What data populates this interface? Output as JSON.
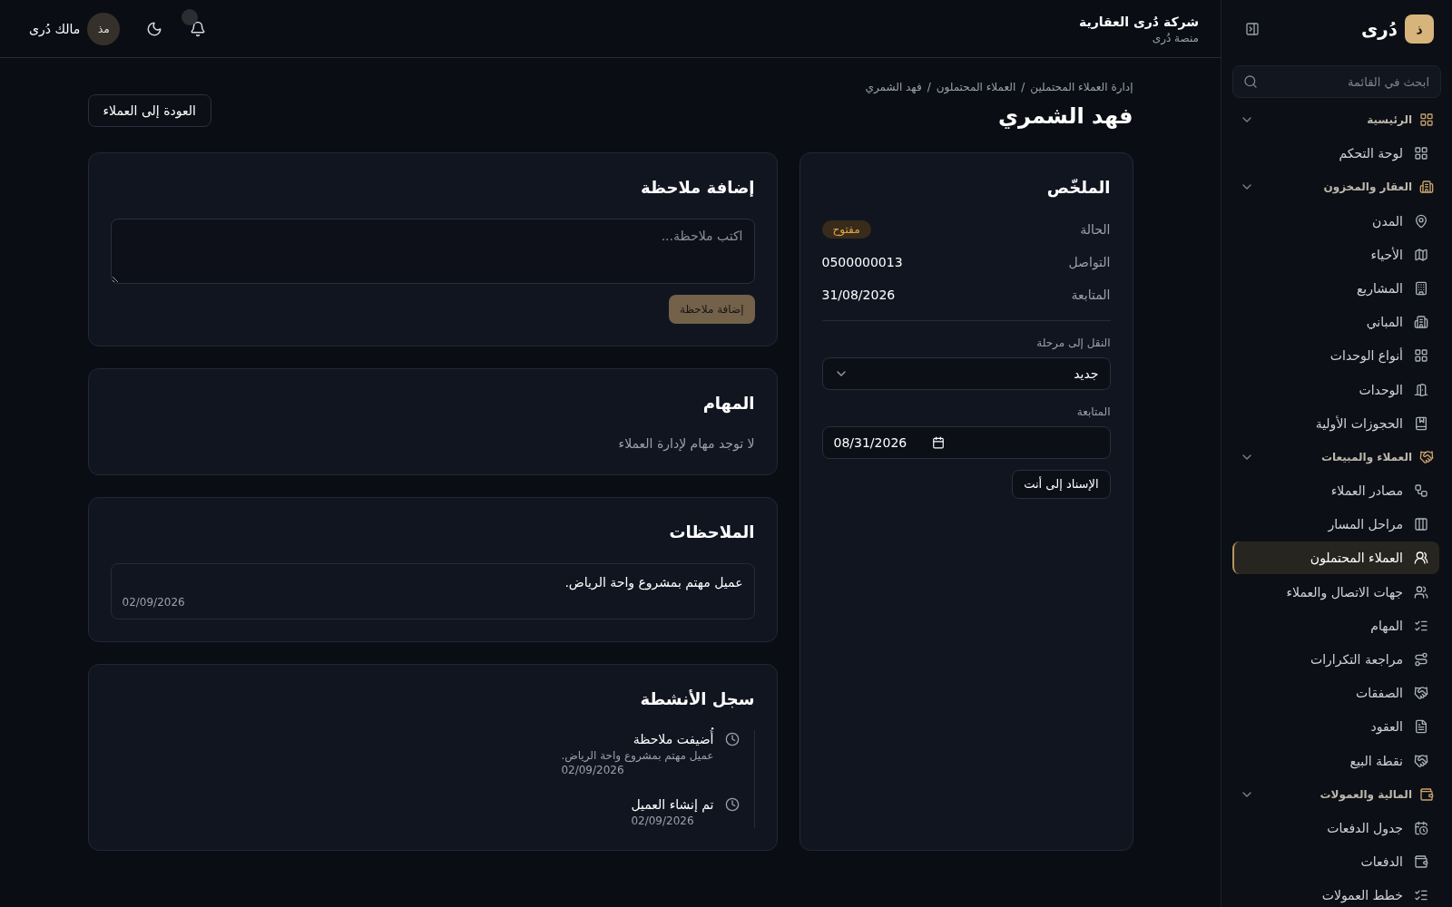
{
  "sidebar": {
    "logo_letter": "ذ",
    "brand": "دُرى",
    "search": {
      "placeholder": "ابحث في القائمة"
    },
    "sections": [
      {
        "label": "الرئيسية",
        "expanded": true,
        "items": [
          {
            "label": "لوحة التحكم",
            "selected": false
          }
        ]
      },
      {
        "label": "العقار والمخزون",
        "expanded": true,
        "items": [
          {
            "label": "المدن",
            "selected": false
          },
          {
            "label": "الأحياء",
            "selected": false
          },
          {
            "label": "المشاريع",
            "selected": false
          },
          {
            "label": "المباني",
            "selected": false
          },
          {
            "label": "أنواع الوحدات",
            "selected": false
          },
          {
            "label": "الوحدات",
            "selected": false
          },
          {
            "label": "الحجوزات الأولية",
            "selected": false
          }
        ]
      },
      {
        "label": "العملاء والمبيعات",
        "expanded": true,
        "items": [
          {
            "label": "مصادر العملاء",
            "selected": false
          },
          {
            "label": "مراحل المسار",
            "selected": false
          },
          {
            "label": "العملاء المحتملون",
            "selected": true
          },
          {
            "label": "جهات الاتصال والعملاء",
            "selected": false
          },
          {
            "label": "المهام",
            "selected": false
          },
          {
            "label": "مراجعة التكرارات",
            "selected": false
          },
          {
            "label": "الصفقات",
            "selected": false
          },
          {
            "label": "العقود",
            "selected": false
          },
          {
            "label": "نقطة البيع",
            "selected": false
          }
        ]
      },
      {
        "label": "المالية والعمولات",
        "expanded": true,
        "items": [
          {
            "label": "جدول الدفعات",
            "selected": false
          },
          {
            "label": "الدفعات",
            "selected": false
          },
          {
            "label": "خطط العمولات",
            "selected": false
          }
        ]
      }
    ]
  },
  "header": {
    "company": "شركة دُرى العقارية",
    "platform": "منصة دُرى",
    "bell_badge": true,
    "user": {
      "initials": "مذ",
      "name": "مالك دُرى"
    }
  },
  "page": {
    "breadcrumb": {
      "separator": "/",
      "items": [
        "إدارة العملاء المحتملين",
        "العملاء المحتملون",
        "فهد الشمري"
      ]
    },
    "title": "فهد الشمري",
    "back_button": "العودة إلى العملاء"
  },
  "summary": {
    "title": "الملخّص",
    "fields": [
      {
        "label": "الحالة",
        "kind": "badge",
        "value": "مفتوح"
      },
      {
        "label": "التواصل",
        "kind": "text",
        "value": "0500000013"
      },
      {
        "label": "المتابعة",
        "kind": "text",
        "value": "31/08/2026"
      }
    ],
    "stage": {
      "label": "النقل إلى مرحلة",
      "value": "جديد"
    },
    "follow_up": {
      "label": "المتابعة",
      "value": "08/31/2026"
    },
    "assign_button": "الإسناد إلى أنت"
  },
  "add_note": {
    "title": "إضافة ملاحظة",
    "placeholder": "اكتب ملاحظة...",
    "button": {
      "label": "إضافة ملاحظة",
      "disabled": true
    }
  },
  "tasks": {
    "title": "المهام",
    "empty_text": "لا توجد مهام لإدارة العملاء"
  },
  "notes": {
    "title": "الملاحظات",
    "items": [
      {
        "text": "عميل مهتم بمشروع واحة الرياض.",
        "date": "02/09/2026"
      }
    ]
  },
  "activity": {
    "title": "سجل الأنشطة",
    "items": [
      {
        "title": "أُضيفت ملاحظة",
        "detail": "عميل مهتم بمشروع واحة الرياض.",
        "date": "02/09/2026"
      },
      {
        "title": "تم إنشاء العميل",
        "date": "02/09/2026"
      }
    ]
  }
}
